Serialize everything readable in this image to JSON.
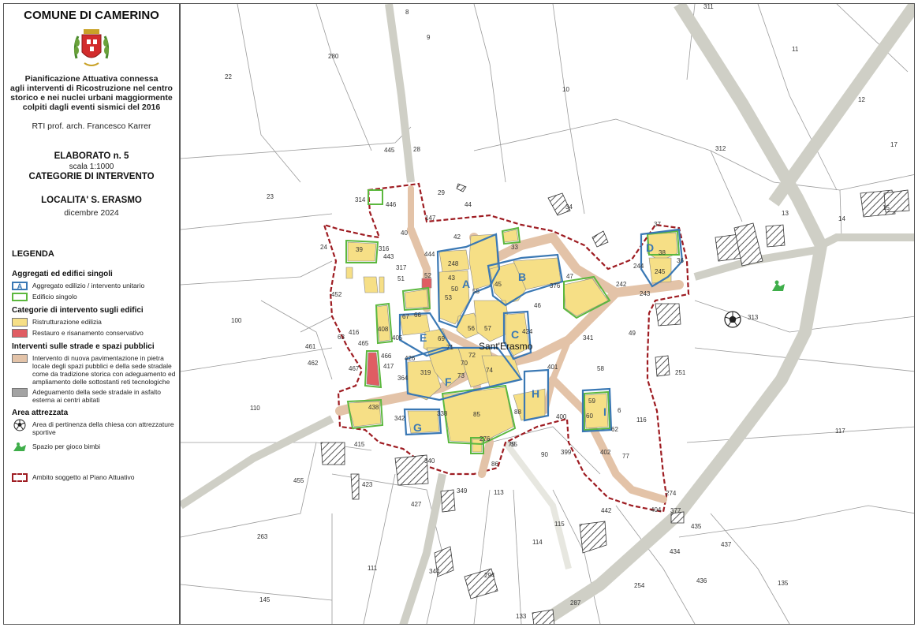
{
  "header": {
    "municipality": "COMUNE DI CAMERINO",
    "subtitle_lines": [
      "Pianificazione Attuativa connessa",
      "agli interventi di Ricostruzione nel centro",
      "storico e nei nuclei urbani maggiormente",
      "colpiti dagli eventi sismici del 2016"
    ],
    "author": "RTI prof. arch. Francesco Karrer",
    "elaborato": "ELABORATO n. 5",
    "scale": "scala 1:1000",
    "category": "CATEGORIE DI INTERVENTO",
    "locality": "LOCALITA' S. ERASMO",
    "date": "dicembre 2024"
  },
  "legend": {
    "title": "LEGENDA",
    "sections": {
      "aggregati": "Aggregati ed edifici singoli",
      "categorie": "Categorie di intervento sugli edifici",
      "strade": "Interventi sulle strade e spazi pubblici",
      "area": "Area attrezzata"
    },
    "items": {
      "aggregato_letter": "A",
      "aggregato": "Aggregato edilizio / intervento unitario",
      "edificio": "Edificio singolo",
      "ristrutturazione": "Ristrutturazione edilizia",
      "restauro": "Restauro e risanamento conservativo",
      "pavimentazione": "Intervento di nuova pavimentazione in pietra locale degli spazi pubblici e della sede stradale come da tradizione storica con adeguamento ed ampliamento delle sottostanti reti tecnologiche",
      "adeguamento": "Adeguamento della sede stradale in asfalto esterna ai centri abitati",
      "chiesa": "Area di pertinenza della chiesa con attrezzature sportive",
      "gioco": "Spazio per gioco bimbi",
      "ambito": "Ambito soggetto al Piano Attuativo"
    }
  },
  "map": {
    "place_name": "Sant'Erasmo",
    "aggregates": [
      "A",
      "B",
      "C",
      "D",
      "E",
      "F",
      "G",
      "H",
      "I"
    ],
    "parcels": [
      "8",
      "9",
      "280",
      "311",
      "11",
      "22",
      "10",
      "12",
      "17",
      "312",
      "445",
      "28",
      "23",
      "314",
      "446",
      "29",
      "44",
      "34",
      "13",
      "14",
      "15",
      "147",
      "40",
      "42",
      "24",
      "39",
      "316",
      "443",
      "444",
      "33",
      "37",
      "317",
      "51",
      "52",
      "248",
      "43",
      "50",
      "53",
      "55",
      "45",
      "B",
      "376",
      "47",
      "242",
      "244",
      "245",
      "243",
      "38",
      "36",
      "452",
      "67",
      "66",
      "46",
      "408",
      "63",
      "56",
      "57",
      "424",
      "341",
      "49",
      "416",
      "465",
      "461",
      "413",
      "405",
      "426",
      "71",
      "72",
      "69",
      "70",
      "74",
      "401",
      "58",
      "251",
      "462",
      "466",
      "417",
      "467",
      "364",
      "319",
      "73",
      "6",
      "59",
      "60",
      "438",
      "342",
      "338",
      "85",
      "88",
      "400",
      "62",
      "116",
      "110",
      "415",
      "276",
      "75",
      "90",
      "399",
      "402",
      "77",
      "349",
      "86",
      "455",
      "423",
      "340",
      "427",
      "113",
      "442",
      "274",
      "404",
      "377",
      "435",
      "263",
      "115",
      "114",
      "437",
      "434",
      "111",
      "344",
      "294",
      "254",
      "436",
      "135",
      "145",
      "133",
      "287",
      "65",
      "100",
      "117",
      "313"
    ]
  },
  "colors": {
    "aggregate_blue": "#3a78b4",
    "building_green": "#5cb83e",
    "ristrutturazione": "#f6df86",
    "restauro": "#e05d63",
    "pavement": "#e3c3a8",
    "road_gray": "#cfcfc6",
    "ambito_red": "#9e1c22"
  }
}
